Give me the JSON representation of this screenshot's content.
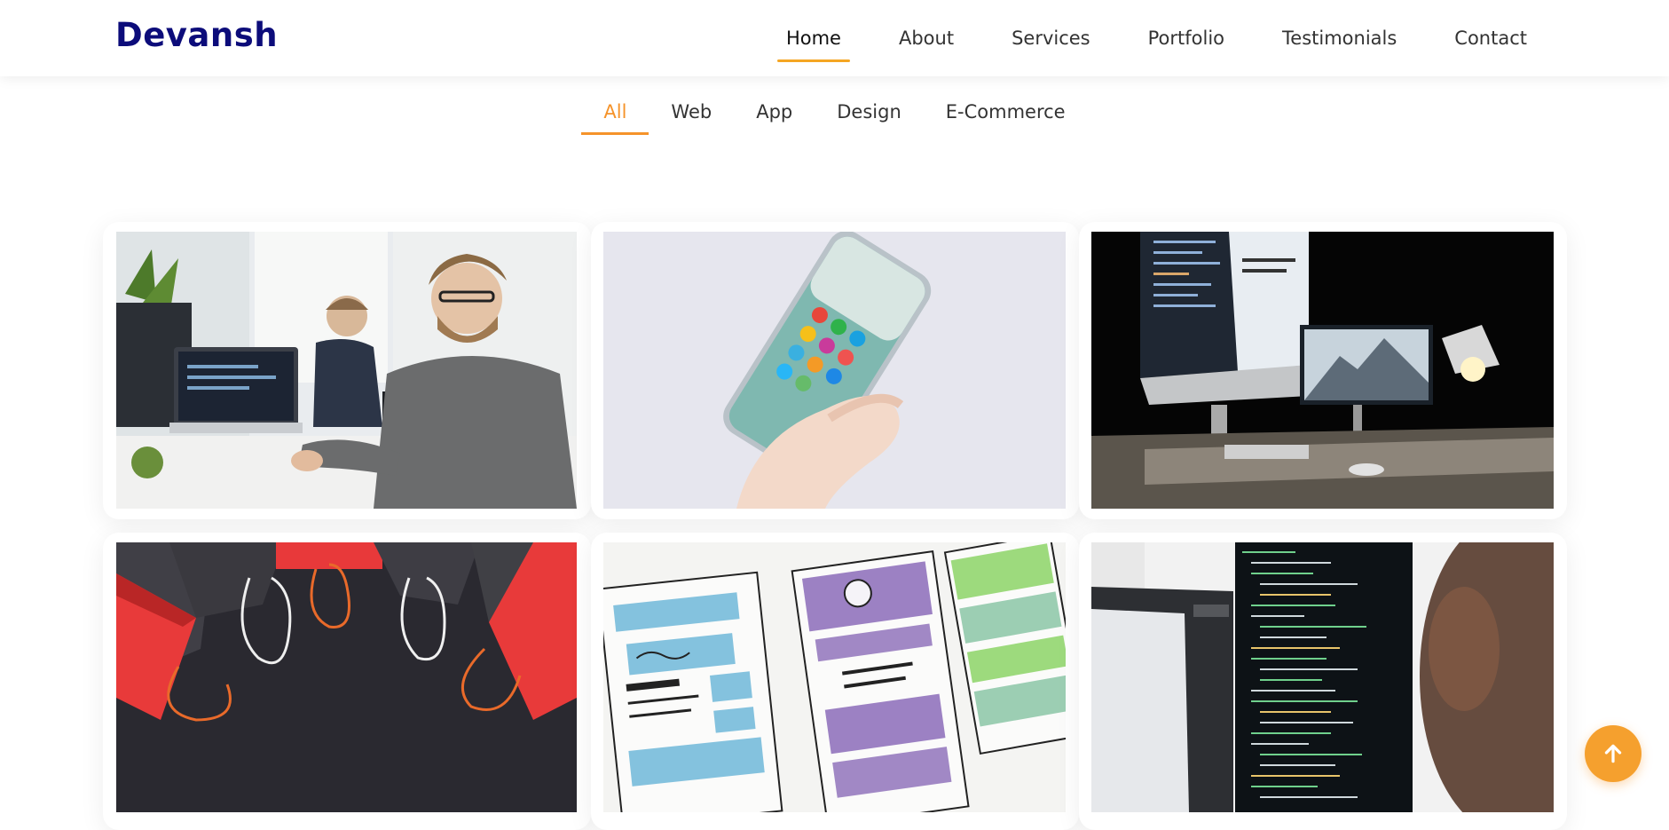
{
  "header": {
    "brand": "Devansh",
    "nav": [
      {
        "label": "Home",
        "active": true
      },
      {
        "label": "About",
        "active": false
      },
      {
        "label": "Services",
        "active": false
      },
      {
        "label": "Portfolio",
        "active": false
      },
      {
        "label": "Testimonials",
        "active": false
      },
      {
        "label": "Contact",
        "active": false
      }
    ]
  },
  "portfolio": {
    "filters": [
      {
        "label": "All",
        "active": true
      },
      {
        "label": "Web",
        "active": false
      },
      {
        "label": "App",
        "active": false
      },
      {
        "label": "Design",
        "active": false
      },
      {
        "label": "E-Commerce",
        "active": false
      }
    ],
    "items": [
      {
        "image": "office-developers-photo"
      },
      {
        "image": "smartphone-apps-photo"
      },
      {
        "image": "dark-desk-monitors-photo"
      },
      {
        "image": "shopping-bags-photo"
      },
      {
        "image": "wireframe-sketches-photo"
      },
      {
        "image": "code-monitor-photo"
      }
    ]
  },
  "back_to_top": {
    "icon": "arrow-up-icon"
  },
  "colors": {
    "brand": "#0c0c7a",
    "accent": "#f5932a",
    "button": "#f5a02e"
  }
}
